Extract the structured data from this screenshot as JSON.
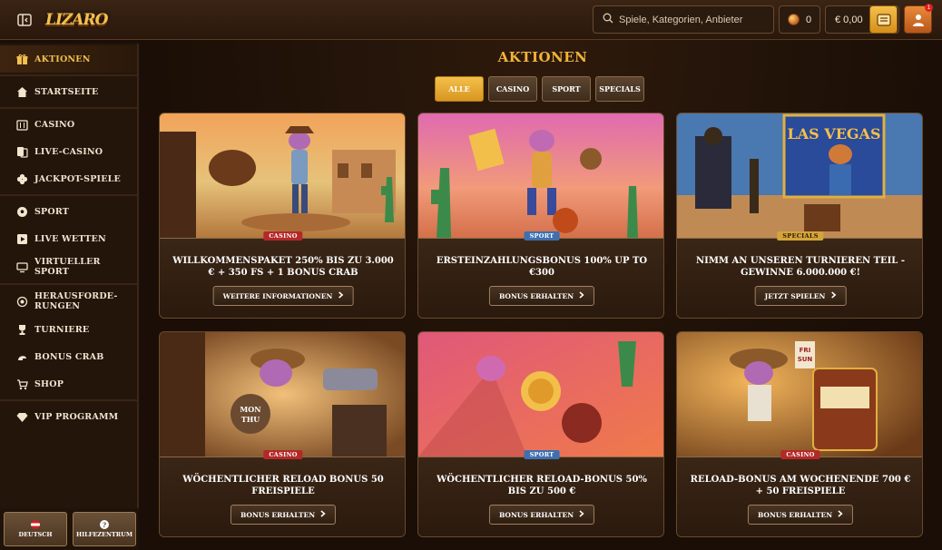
{
  "header": {
    "logo_text": "LIZARO",
    "search_placeholder": "Spiele, Kategorien, Anbieter",
    "coins_count": "0",
    "balance": "€ 0,00",
    "notification_count": "1"
  },
  "sidebar": {
    "items": [
      {
        "label": "AKTIONEN",
        "icon": "gift-icon"
      },
      {
        "label": "STARTSEITE",
        "icon": "home-icon"
      },
      {
        "label": "CASINO",
        "icon": "casino-icon"
      },
      {
        "label": "LIVE-CASINO",
        "icon": "cards-icon"
      },
      {
        "label": "JACKPOT-SPIELE",
        "icon": "clover-icon"
      },
      {
        "label": "SPORT",
        "icon": "soccer-ball-icon"
      },
      {
        "label": "LIVE WETTEN",
        "icon": "play-icon"
      },
      {
        "label": "VIRTUELLER SPORT",
        "icon": "screen-icon"
      },
      {
        "label": "HERAUSFORDE-RUNGEN",
        "icon": "target-icon"
      },
      {
        "label": "TURNIERE",
        "icon": "trophy-icon"
      },
      {
        "label": "BONUS CRAB",
        "icon": "crab-icon"
      },
      {
        "label": "SHOP",
        "icon": "cart-icon"
      },
      {
        "label": "VIP PROGRAMM",
        "icon": "diamond-icon"
      }
    ],
    "language_label": "DEUTSCH",
    "help_label": "HILFEZENTRUM"
  },
  "main": {
    "title": "AKTIONEN",
    "filters": [
      {
        "label": "ALLE",
        "active": true
      },
      {
        "label": "CASINO",
        "active": false
      },
      {
        "label": "SPORT",
        "active": false
      },
      {
        "label": "SPECIALS",
        "active": false
      }
    ],
    "cards": [
      {
        "tag": "CASINO",
        "tag_type": "casino",
        "title": "WILLKOMMENSPAKET 250% BIS ZU 3.000 € + 350 FS + 1 BONUS CRAB",
        "button": "WEITERE INFORMATIONEN"
      },
      {
        "tag": "SPORT",
        "tag_type": "sport",
        "title": "ERSTEINZAHLUNGSBONUS 100% UP TO €300",
        "button": "BONUS ERHALTEN"
      },
      {
        "tag": "SPECIALS",
        "tag_type": "specials",
        "title": "NIMM AN UNSEREN TURNIEREN TEIL - GEWINNE 6.000.000 €!",
        "button": "JETZT SPIELEN"
      },
      {
        "tag": "CASINO",
        "tag_type": "casino",
        "title": "WÖCHENTLICHER RELOAD BONUS 50 FREISPIELE",
        "button": "BONUS ERHALTEN"
      },
      {
        "tag": "SPORT",
        "tag_type": "sport",
        "title": "WÖCHENTLICHER RELOAD-BONUS 50% BIS ZU 500 €",
        "button": "BONUS ERHALTEN"
      },
      {
        "tag": "CASINO",
        "tag_type": "casino",
        "title": "RELOAD-BONUS AM WOCHENENDE 700 € + 50 FREISPIELE",
        "button": "BONUS ERHALTEN"
      }
    ]
  }
}
